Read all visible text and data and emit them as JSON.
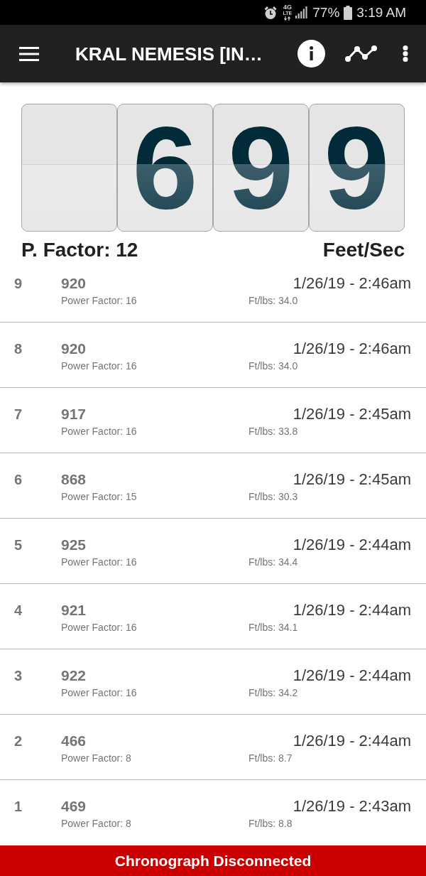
{
  "status_bar": {
    "network_type": "4G",
    "network_sub": "LTE",
    "battery": "77%",
    "time": "3:19 AM"
  },
  "app_bar": {
    "title": "KRAL NEMESIS [IN…"
  },
  "speed_display": {
    "value": "699",
    "power_factor": "P. Factor: 12",
    "unit": "Feet/Sec"
  },
  "shots": [
    {
      "number": "9",
      "speed": "920",
      "power_factor": "Power Factor: 16",
      "energy": "Ft/lbs: 34.0",
      "time": "1/26/19 - 2:46am"
    },
    {
      "number": "8",
      "speed": "920",
      "power_factor": "Power Factor: 16",
      "energy": "Ft/lbs: 34.0",
      "time": "1/26/19 - 2:46am"
    },
    {
      "number": "7",
      "speed": "917",
      "power_factor": "Power Factor: 16",
      "energy": "Ft/lbs: 33.8",
      "time": "1/26/19 - 2:45am"
    },
    {
      "number": "6",
      "speed": "868",
      "power_factor": "Power Factor: 15",
      "energy": "Ft/lbs: 30.3",
      "time": "1/26/19 - 2:45am"
    },
    {
      "number": "5",
      "speed": "925",
      "power_factor": "Power Factor: 16",
      "energy": "Ft/lbs: 34.4",
      "time": "1/26/19 - 2:44am"
    },
    {
      "number": "4",
      "speed": "921",
      "power_factor": "Power Factor: 16",
      "energy": "Ft/lbs: 34.1",
      "time": "1/26/19 - 2:44am"
    },
    {
      "number": "3",
      "speed": "922",
      "power_factor": "Power Factor: 16",
      "energy": "Ft/lbs: 34.2",
      "time": "1/26/19 - 2:44am"
    },
    {
      "number": "2",
      "speed": "466",
      "power_factor": "Power Factor: 8",
      "energy": "Ft/lbs: 8.7",
      "time": "1/26/19 - 2:44am"
    },
    {
      "number": "1",
      "speed": "469",
      "power_factor": "Power Factor: 8",
      "energy": "Ft/lbs: 8.8",
      "time": "1/26/19 - 2:43am"
    }
  ],
  "status_banner": {
    "text": "Chronograph Disconnected"
  }
}
